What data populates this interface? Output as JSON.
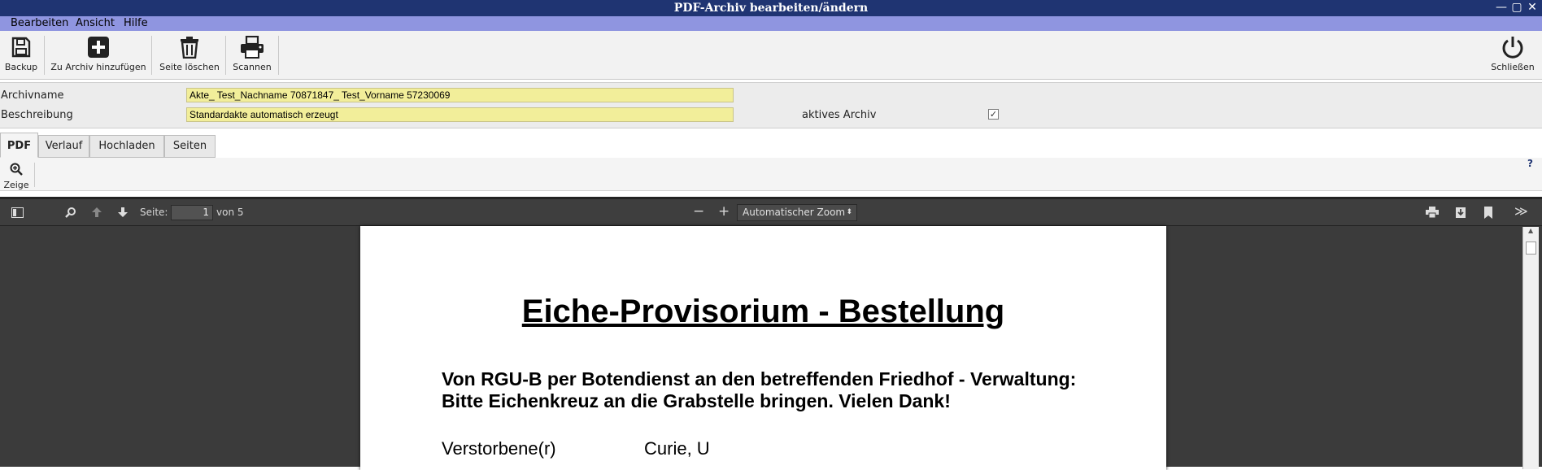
{
  "window": {
    "title": "PDF-Archiv bearbeiten/ändern",
    "controls": {
      "minimize": "—",
      "maximize": "▢",
      "close": "✕"
    }
  },
  "menubar": {
    "items": [
      "Bearbeiten",
      "Ansicht",
      "Hilfe"
    ]
  },
  "toolbar": {
    "backup": {
      "label": "Backup",
      "icon": "save-icon"
    },
    "add": {
      "label": "Zu Archiv hinzufügen",
      "icon": "plus-square-icon"
    },
    "delete": {
      "label": "Seite löschen",
      "icon": "trash-icon"
    },
    "scan": {
      "label": "Scannen",
      "icon": "printer-icon"
    },
    "close": {
      "label": "Schließen",
      "icon": "power-icon"
    }
  },
  "form": {
    "archivname_label": "Archivname",
    "archivname_value": "Akte_ Test_Nachname 70871847_ Test_Vorname 57230069",
    "beschreibung_label": "Beschreibung",
    "beschreibung_value": "Standardakte automatisch erzeugt",
    "aktiv_label": "aktives Archiv",
    "aktiv_checked": true,
    "aktiv_mark": "✓"
  },
  "tabs": [
    "PDF",
    "Verlauf",
    "Hochladen",
    "Seiten"
  ],
  "subtoolbar": {
    "zeige_label": "Zeige",
    "help": "?"
  },
  "viewer": {
    "page_label": "Seite:",
    "page_current": "1",
    "page_total": "von 5",
    "zoom": "Automatischer Zoom",
    "zoom_out": "−",
    "zoom_in": "+",
    "more": "≫"
  },
  "document": {
    "title": "Eiche-Provisorium - Bestellung",
    "line1": "Von RGU-B per Botendienst an den betreffenden Friedhof - Verwaltung:",
    "line2": "Bitte Eichenkreuz an die Grabstelle bringen.   Vielen Dank!",
    "field_label": "Verstorbene(r)",
    "field_value": "Curie, U"
  }
}
